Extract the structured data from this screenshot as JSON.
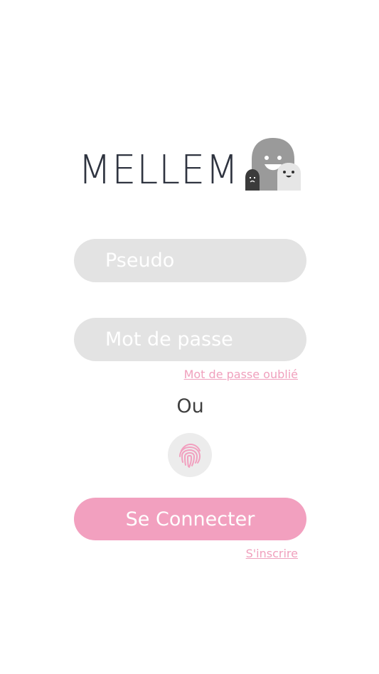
{
  "logo": {
    "text": "MELLEM"
  },
  "form": {
    "username_placeholder": "Pseudo",
    "password_placeholder": "Mot de passe",
    "forgot_password_link": "Mot de passe oublié",
    "or_separator": "Ou",
    "fingerprint_icon": "fingerprint-icon",
    "submit_label": "Se Connecter",
    "signup_link": "S'inscrire"
  },
  "colors": {
    "accent": "#f2a0bf",
    "field_bg": "#e3e3e3",
    "text_dark": "#2f3440"
  }
}
